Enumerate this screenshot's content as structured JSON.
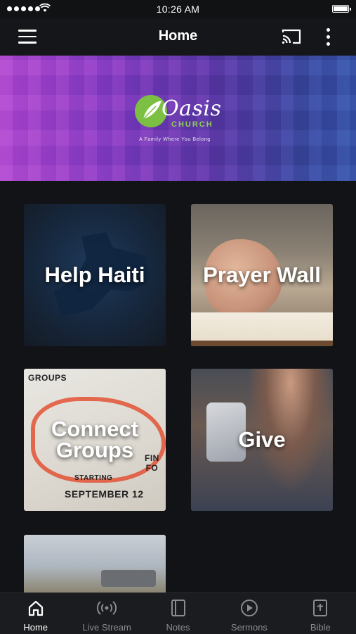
{
  "status_bar": {
    "time": "10:26 AM"
  },
  "nav": {
    "title": "Home"
  },
  "banner": {
    "logo_name": "Oasis",
    "logo_sub": "CHURCH",
    "tagline": "A Family Where You Belong"
  },
  "tiles": [
    {
      "label": "Help Haiti"
    },
    {
      "label": "Prayer Wall"
    },
    {
      "label": "Connect\nGroups",
      "line1": "Connect",
      "line2": "Groups",
      "art_top": "GROUPS",
      "art_start": "STARTING",
      "art_date": "SEPTEMBER 12",
      "art_side": "FIN\nFO"
    },
    {
      "label": "Give"
    },
    {
      "label": ""
    }
  ],
  "tabs": [
    {
      "label": "Home",
      "icon": "home-icon",
      "active": true
    },
    {
      "label": "Live Stream",
      "icon": "broadcast-icon",
      "active": false
    },
    {
      "label": "Notes",
      "icon": "notes-icon",
      "active": false
    },
    {
      "label": "Sermons",
      "icon": "play-circle-icon",
      "active": false
    },
    {
      "label": "Bible",
      "icon": "bible-icon",
      "active": false
    }
  ],
  "colors": {
    "background": "#121316",
    "tab_active": "#ffffff",
    "tab_inactive": "#8a8b8e",
    "logo_green": "#7bc043"
  }
}
